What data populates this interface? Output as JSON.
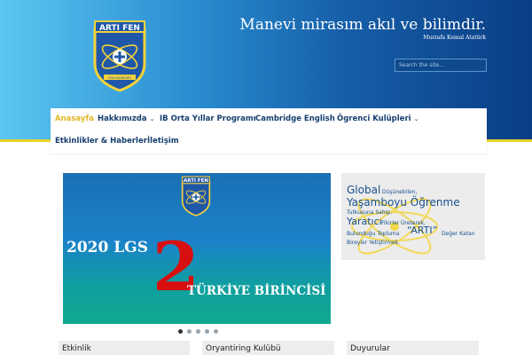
{
  "header": {
    "logo": {
      "title": "ARTI FEN",
      "ribbon": "FEN BİLİMLERİ"
    },
    "motto": "Manevi mirasım akıl ve bilimdir.",
    "motto_author": "Mustafa Kemal Atatürk",
    "search": {
      "placeholder": "Search the site...",
      "value": ""
    },
    "colors": {
      "band_start": "#5cc7f1",
      "band_end": "#0a3e85",
      "accent_line": "#e7d22a"
    }
  },
  "nav": {
    "items": [
      {
        "label": "Anasayfa",
        "active": true,
        "has_submenu": false
      },
      {
        "label": "Hakkımızda",
        "active": false,
        "has_submenu": true
      },
      {
        "label": "IB Orta Yıllar Programı",
        "active": false,
        "has_submenu": false
      },
      {
        "label": "Cambridge English",
        "active": false,
        "has_submenu": false
      },
      {
        "label": "Ögrenci Kulüpleri",
        "active": false,
        "has_submenu": true
      },
      {
        "label": "Etkinlikler & Haberler",
        "active": false,
        "has_submenu": false
      },
      {
        "label": "İletişim",
        "active": false,
        "has_submenu": false
      }
    ],
    "submenu_icon": "chevron-down-icon",
    "colors": {
      "text": "#163e6e",
      "active": "#e2b623"
    }
  },
  "slider": {
    "logo_title": "ARTI FEN",
    "headline": "2020 LGS",
    "big_number": "2",
    "subtitle": "TÜRKİYE BİRİNCİSİ",
    "slide_count": 5,
    "active_slide": 1,
    "colors": {
      "number": "#d80f0f"
    }
  },
  "side_panel": {
    "words": {
      "global": "Global",
      "dusunebilen": "Düşünebilen,",
      "yasamboyu": "Yaşamboyu Öğrenme",
      "tutkusuna": "Tutkusuna Sahip,",
      "yaratici": "Yaratıcı",
      "fikirler": "Fikirler Üreterek,",
      "bulundugu": "Bulunduğu Topluma",
      "arti": "“ARTI”",
      "deger": "Değer Katan",
      "bireyler": "Bireyler Yetiştirmek."
    },
    "colors": {
      "text": "#17508f",
      "atom": "#f2d84a"
    }
  },
  "boxes": [
    {
      "title": "Etkinlik"
    },
    {
      "title": "Oryantiring Kulübü"
    },
    {
      "title": "Duyurular"
    }
  ]
}
